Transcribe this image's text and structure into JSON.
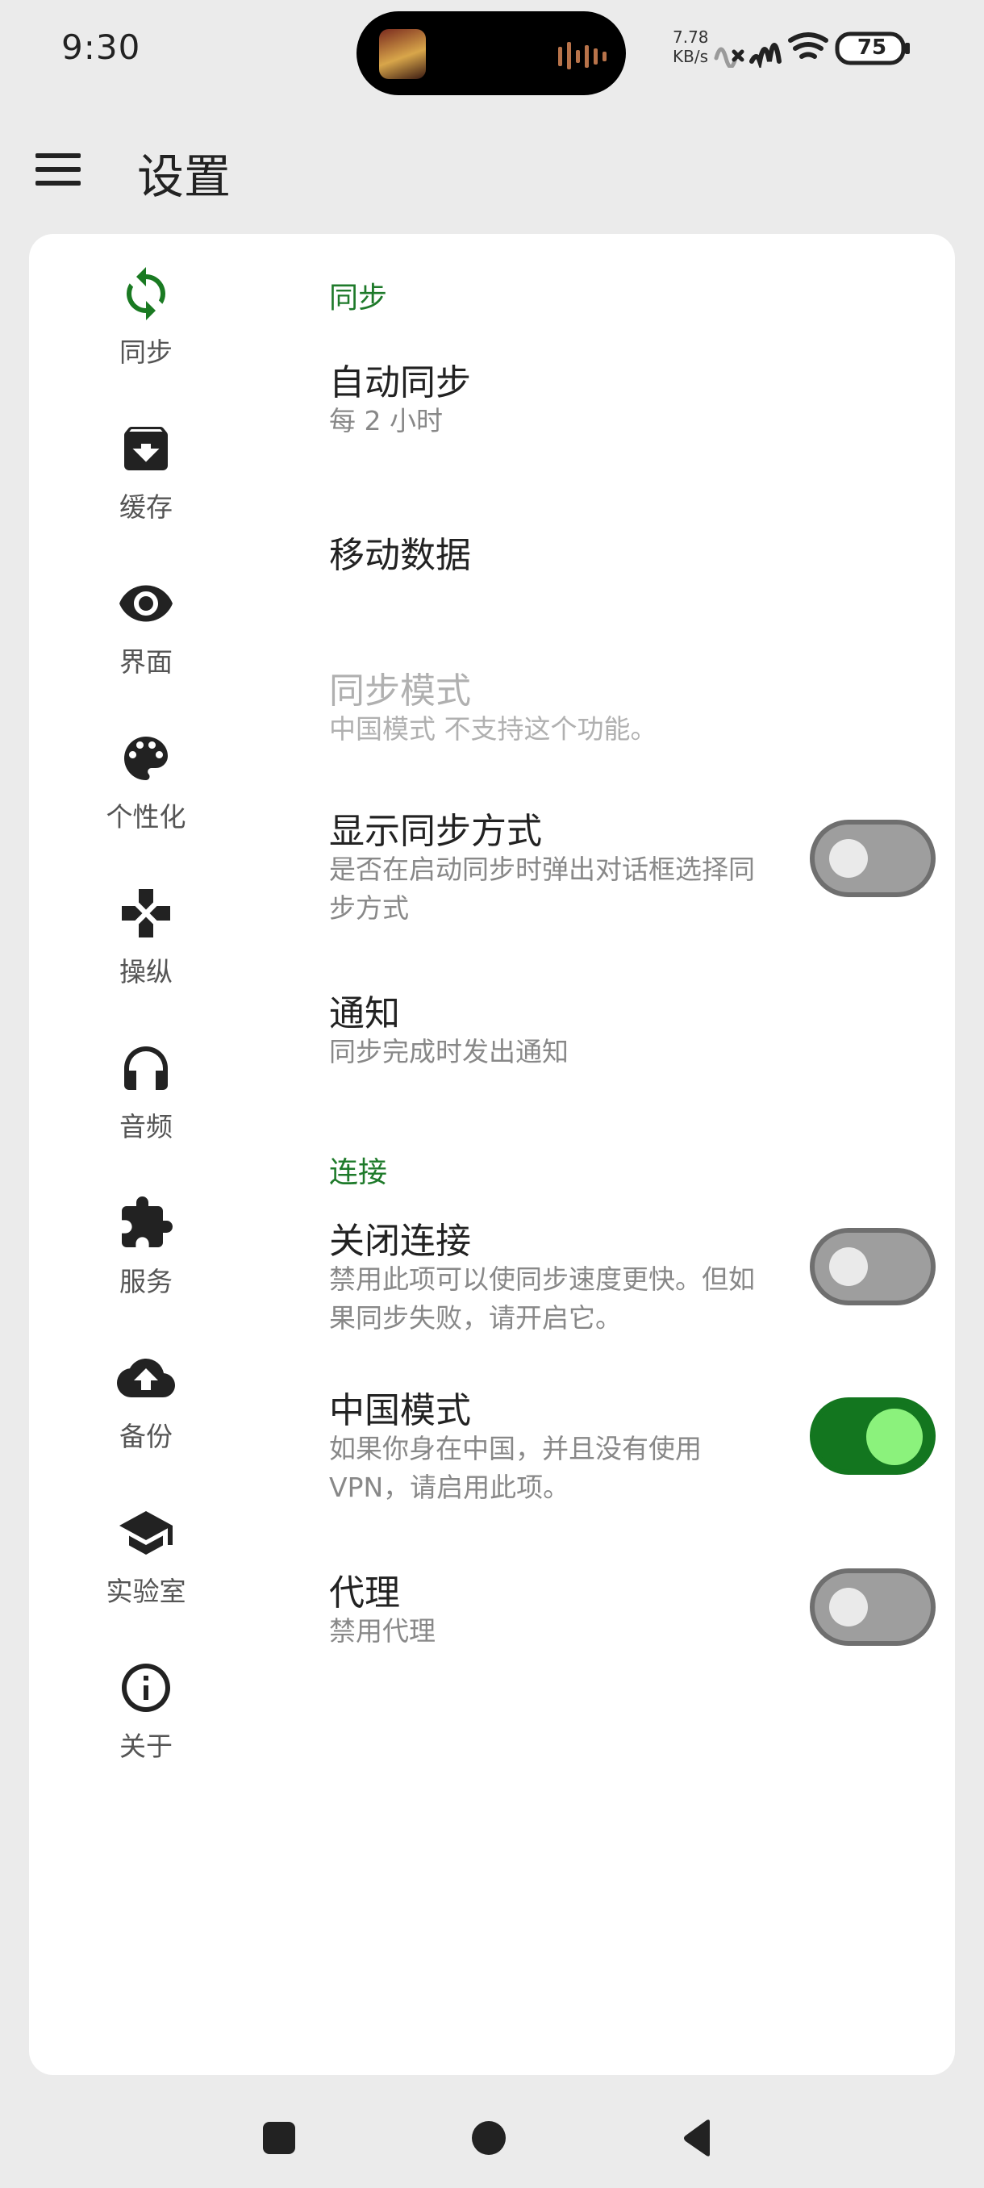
{
  "status_bar": {
    "time": "9:30",
    "net_speed_value": "7.78",
    "net_speed_unit": "KB/s",
    "battery": "75",
    "icons": [
      "now-playing-thumbnail",
      "audio-wave-icon",
      "mobile-signal-off-icon",
      "signal-icon",
      "wifi-icon",
      "battery-icon"
    ]
  },
  "app_bar": {
    "menu_icon": "hamburger-menu-icon",
    "title": "设置"
  },
  "rail": {
    "items": [
      {
        "label": "同步",
        "icon": "sync-icon",
        "active": true
      },
      {
        "label": "缓存",
        "icon": "archive-icon"
      },
      {
        "label": "界面",
        "icon": "eye-icon"
      },
      {
        "label": "个性化",
        "icon": "palette-icon"
      },
      {
        "label": "操纵",
        "icon": "dpad-icon"
      },
      {
        "label": "音频",
        "icon": "headphones-icon"
      },
      {
        "label": "服务",
        "icon": "puzzle-icon"
      },
      {
        "label": "备份",
        "icon": "cloud-upload-icon"
      },
      {
        "label": "实验室",
        "icon": "school-icon"
      },
      {
        "label": "关于",
        "icon": "info-icon"
      }
    ]
  },
  "sections": {
    "sync": {
      "header": "同步",
      "auto_sync": {
        "title": "自动同步",
        "summary": "每 2 小时"
      },
      "mobile_data": {
        "title": "移动数据"
      },
      "sync_mode": {
        "title": "同步模式",
        "summary": "中国模式 不支持这个功能。",
        "enabled": false
      },
      "show_sync_method": {
        "title": "显示同步方式",
        "summary": "是否在启动同步时弹出对话框选择同步方式",
        "checked": false
      },
      "notification": {
        "title": "通知",
        "summary": "同步完成时发出通知"
      }
    },
    "connection": {
      "header": "连接",
      "close_connection": {
        "title": "关闭连接",
        "summary": "禁用此项可以使同步速度更快。但如果同步失败，请开启它。",
        "checked": false
      },
      "china_mode": {
        "title": "中国模式",
        "summary": "如果你身在中国，并且没有使用 VPN，请启用此项。",
        "checked": true
      },
      "proxy": {
        "title": "代理",
        "summary": "禁用代理",
        "checked": false
      }
    }
  },
  "nav_bar": {
    "icons": [
      "recents-square-icon",
      "home-circle-icon",
      "back-triangle-icon"
    ]
  },
  "colors": {
    "accent": "#1e7a2a",
    "switch_on_track": "#13761f",
    "switch_on_thumb": "#8bf27c",
    "background": "#ebebeb"
  }
}
